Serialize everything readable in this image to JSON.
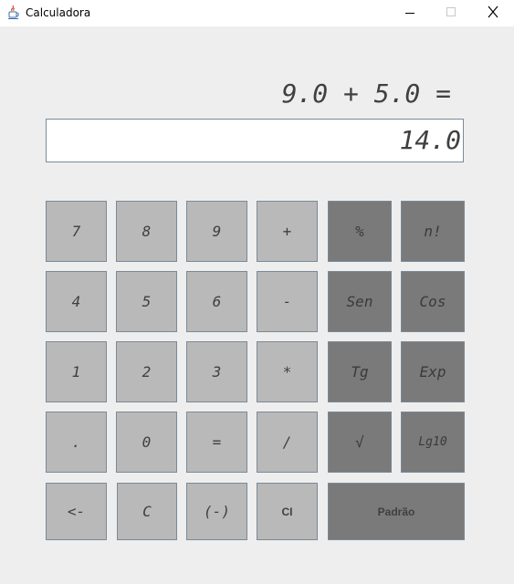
{
  "window": {
    "title": "Calculadora",
    "icon": "java-cup-icon"
  },
  "expression": "9.0 + 5.0 =",
  "display": {
    "value": "14.0"
  },
  "keys": {
    "k7": "7",
    "k8": "8",
    "k9": "9",
    "plus": "+",
    "percent": "%",
    "factorial": "n!",
    "k4": "4",
    "k5": "5",
    "k6": "6",
    "minus": "-",
    "sen": "Sen",
    "cos": "Cos",
    "k1": "1",
    "k2": "2",
    "k3": "3",
    "multiply": "*",
    "tg": "Tg",
    "exp": "Exp",
    "dot": ".",
    "k0": "0",
    "equals": "=",
    "divide": "/",
    "sqrt": "√",
    "lg10": "Lg10",
    "backspace": "<-",
    "clear": "C",
    "negate": "(-)",
    "clear_input": "CI",
    "default": "Padrão"
  },
  "colors": {
    "light_key": "#b9b9b9",
    "dark_key": "#7a7a7a",
    "background": "#eeeeee",
    "display_bg": "#ffffff"
  }
}
